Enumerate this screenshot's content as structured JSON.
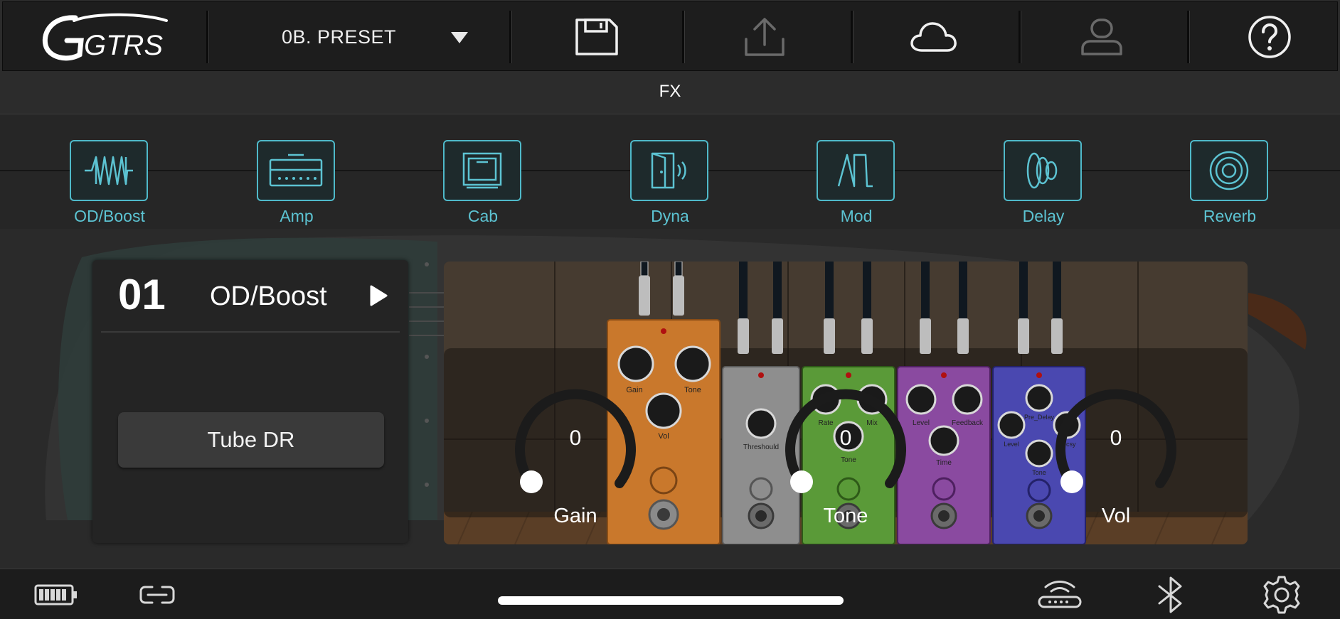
{
  "app": {
    "logo_text": "GTRS"
  },
  "header": {
    "preset_name": "0B. PRESET",
    "icons": [
      "save-icon",
      "upload-icon",
      "cloud-icon",
      "user-icon",
      "help-icon"
    ]
  },
  "fx_title": "FX",
  "effects": [
    {
      "label": "OD/Boost",
      "icon": "od-boost-icon"
    },
    {
      "label": "Amp",
      "icon": "amp-icon"
    },
    {
      "label": "Cab",
      "icon": "cab-icon"
    },
    {
      "label": "Dyna",
      "icon": "dyna-icon"
    },
    {
      "label": "Mod",
      "icon": "mod-icon"
    },
    {
      "label": "Delay",
      "icon": "delay-icon"
    },
    {
      "label": "Reverb",
      "icon": "reverb-icon"
    }
  ],
  "module": {
    "number": "01",
    "type": "OD/Boost",
    "model": "Tube DR"
  },
  "pedals": [
    {
      "color": "#cf7a2e",
      "knobs": [
        "Gain",
        "Tone",
        "Vol"
      ]
    },
    {
      "color": "#8c8c8c",
      "knobs": [
        "Threshould"
      ]
    },
    {
      "color": "#5b9a3a",
      "knobs": [
        "Rate",
        "Mix",
        "Tone"
      ]
    },
    {
      "color": "#8a4aa0",
      "knobs": [
        "Level",
        "Feedback",
        "Time"
      ]
    },
    {
      "color": "#4b4ab0",
      "knobs": [
        "Pre_Delay",
        "Level",
        "Decsy",
        "Tone"
      ]
    }
  ],
  "knobs": [
    {
      "label": "Gain",
      "value": "0"
    },
    {
      "label": "Tone",
      "value": "0"
    },
    {
      "label": "Vol",
      "value": "0"
    }
  ],
  "colors": {
    "accent": "#4fb9c9",
    "background": "#2c2c2c"
  },
  "footer": {
    "icons": [
      "battery-icon",
      "link-icon",
      "home-indicator",
      "wireless-icon",
      "bluetooth-icon",
      "settings-icon"
    ]
  }
}
